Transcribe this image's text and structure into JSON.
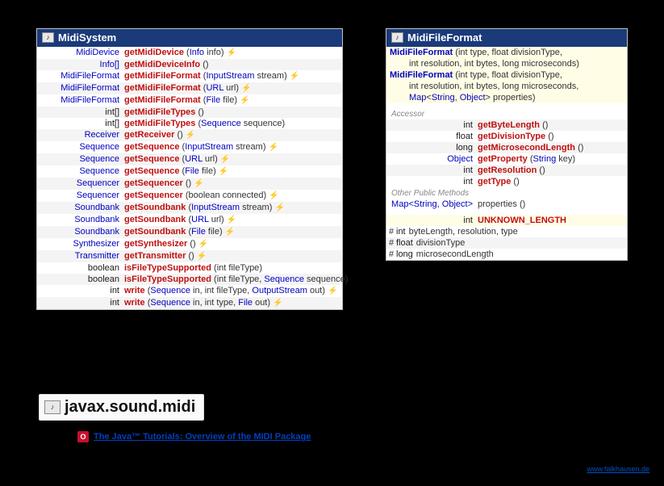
{
  "midiSystem": {
    "title": "MidiSystem",
    "rows": [
      {
        "ret": "MidiDevice",
        "method": "getMidiDevice",
        "params": "(Info info)",
        "throws": true,
        "alt": false
      },
      {
        "ret": "Info[]",
        "method": "getMidiDeviceInfo",
        "params": "()",
        "throws": false,
        "alt": true
      },
      {
        "ret": "MidiFileFormat",
        "method": "getMidiFileFormat",
        "params": "(InputStream stream)",
        "throws": true,
        "alt": false
      },
      {
        "ret": "MidiFileFormat",
        "method": "getMidiFileFormat",
        "params": "(URL url)",
        "throws": true,
        "alt": true
      },
      {
        "ret": "MidiFileFormat",
        "method": "getMidiFileFormat",
        "params": "(File file)",
        "throws": true,
        "alt": false
      },
      {
        "ret": "int[]",
        "method": "getMidiFileTypes",
        "params": "()",
        "throws": false,
        "alt": true,
        "retKw": true
      },
      {
        "ret": "int[]",
        "method": "getMidiFileTypes",
        "params": "(Sequence sequence)",
        "throws": false,
        "alt": false,
        "retKw": true
      },
      {
        "ret": "Receiver",
        "method": "getReceiver",
        "params": "()",
        "throws": true,
        "alt": true
      },
      {
        "ret": "Sequence",
        "method": "getSequence",
        "params": "(InputStream stream)",
        "throws": true,
        "alt": false
      },
      {
        "ret": "Sequence",
        "method": "getSequence",
        "params": "(URL url)",
        "throws": true,
        "alt": true
      },
      {
        "ret": "Sequence",
        "method": "getSequence",
        "params": "(File file)",
        "throws": true,
        "alt": false
      },
      {
        "ret": "Sequencer",
        "method": "getSequencer",
        "params": "()",
        "throws": true,
        "alt": true
      },
      {
        "ret": "Sequencer",
        "method": "getSequencer",
        "params": "(boolean connected)",
        "throws": true,
        "alt": false,
        "kwParam": true
      },
      {
        "ret": "Soundbank",
        "method": "getSoundbank",
        "params": "(InputStream stream)",
        "throws": true,
        "alt": true
      },
      {
        "ret": "Soundbank",
        "method": "getSoundbank",
        "params": "(URL url)",
        "throws": true,
        "alt": false
      },
      {
        "ret": "Soundbank",
        "method": "getSoundbank",
        "params": "(File file)",
        "throws": true,
        "alt": true
      },
      {
        "ret": "Synthesizer",
        "method": "getSynthesizer",
        "params": "()",
        "throws": true,
        "alt": false
      },
      {
        "ret": "Transmitter",
        "method": "getTransmitter",
        "params": "()",
        "throws": true,
        "alt": true
      },
      {
        "ret": "boolean",
        "method": "isFileTypeSupported",
        "params": "(int fileType)",
        "throws": false,
        "alt": false,
        "retKw": true,
        "kwParam": true
      },
      {
        "ret": "boolean",
        "method": "isFileTypeSupported",
        "paramsHtml": "(<span class='p'>int fileType, </span><span class='t'>Sequence</span><span class='p'> sequence</span>)",
        "throws": false,
        "alt": true,
        "retKw": true
      },
      {
        "ret": "int",
        "method": "write",
        "paramsHtml": "(<span class='t'>Sequence</span><span class='p'> in, int fileType, </span><span class='t'>OutputStream</span><span class='p'> out</span>)",
        "throws": true,
        "alt": false,
        "retKw": true
      },
      {
        "ret": "int",
        "method": "write",
        "paramsHtml": "(<span class='t'>Sequence</span><span class='p'> in, int type, </span><span class='t'>File</span><span class='p'> out</span>)",
        "throws": true,
        "alt": true,
        "retKw": true
      }
    ]
  },
  "midiFileFormat": {
    "title": "MidiFileFormat",
    "ctor1": {
      "name": "MidiFileFormat",
      "line1": "(int type, float divisionType,",
      "line2": "int resolution, int bytes, long microseconds)"
    },
    "ctor2": {
      "name": "MidiFileFormat",
      "line1": "(int type, float divisionType,",
      "line2": "int resolution, int bytes, long microseconds,",
      "line3html": "<span class='t'>Map</span><span class='p'>&lt;</span><span class='t'>String</span><span class='p'>, </span><span class='t'>Object</span><span class='p'>&gt; properties)</span>"
    },
    "secAccessor": "Accessor",
    "accessors": [
      {
        "ret": "int",
        "method": "getByteLength",
        "params": "()",
        "retKw": true,
        "alt": true
      },
      {
        "ret": "float",
        "method": "getDivisionType",
        "params": "()",
        "retKw": true,
        "alt": false
      },
      {
        "ret": "long",
        "method": "getMicrosecondLength",
        "params": "()",
        "retKw": true,
        "alt": true
      },
      {
        "ret": "Object",
        "method": "getProperty",
        "paramsHtml": "(<span class='t'>String</span><span class='p'> key</span>)",
        "alt": false
      },
      {
        "ret": "int",
        "method": "getResolution",
        "params": "()",
        "retKw": true,
        "alt": true
      },
      {
        "ret": "int",
        "method": "getType",
        "params": "()",
        "retKw": true,
        "alt": false
      }
    ],
    "secOther": "Other Public Methods",
    "other": [
      {
        "retHtml": "<span class='t'>Map</span><span class='p'>&lt;</span><span class='t'>String</span><span class='p'>, </span><span class='t'>Object</span><span class='p'>&gt;</span>",
        "method": "properties",
        "params": "()",
        "alt": false
      }
    ],
    "constants": [
      {
        "type": "int",
        "name": "UNKNOWN_LENGTH"
      }
    ],
    "fields": [
      {
        "vis": "#",
        "type": "int",
        "names": "byteLength, resolution, type"
      },
      {
        "vis": "#",
        "type": "float",
        "names": "divisionType"
      },
      {
        "vis": "#",
        "type": "long",
        "names": "microsecondLength"
      }
    ]
  },
  "package": {
    "name": "javax.sound.midi"
  },
  "tutorial": {
    "label": "The Java™ Tutorials: Overview of the MIDI Package"
  },
  "footer": {
    "url": "www.falkhausen.de"
  }
}
